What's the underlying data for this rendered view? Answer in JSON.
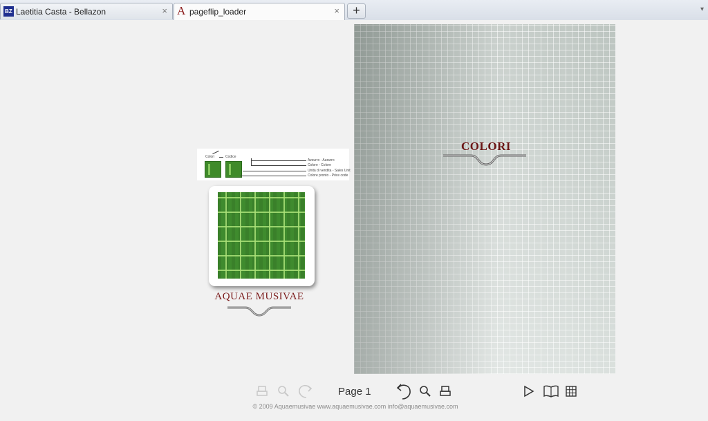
{
  "tabs": [
    {
      "label": "Laetitia Casta - Bellazon",
      "favicon": "BZ",
      "close": "×"
    },
    {
      "label": "pageflip_loader",
      "favicon": "A",
      "close": "×"
    }
  ],
  "new_tab": "+",
  "tab_menu": "▾",
  "legend": {
    "label_left": "Colori",
    "label_mid": "Codice",
    "lines": [
      "Azzurro - Azzurro",
      "Colore - Colore",
      "Unità di vendita - Sales Unit",
      "Colore pronto - Price code"
    ]
  },
  "brand": "AQUAE MUSIVAE",
  "page": {
    "title": "COLORI"
  },
  "controls": {
    "page_label": "Page 1"
  },
  "footer": "© 2009 Aquaemusivae www.aquaemusivae.com info@aquaemusivae.com",
  "colors": {
    "accent": "#6b1515",
    "tile_green": "#3f8b2e"
  }
}
